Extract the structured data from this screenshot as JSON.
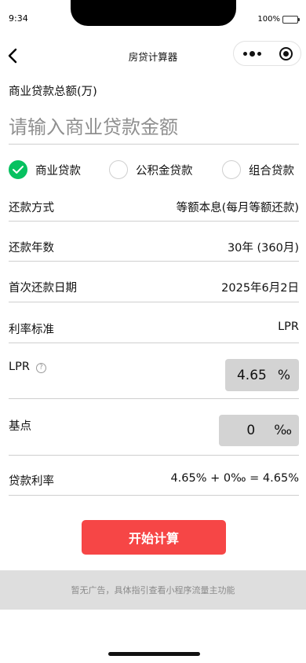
{
  "status_bar": {
    "time": "9:34",
    "battery": "100%"
  },
  "nav": {
    "title": "房贷计算器"
  },
  "loan_amount": {
    "label": "商业贷款总额(万)",
    "placeholder": "请输入商业贷款金额",
    "value": ""
  },
  "loan_types": [
    {
      "label": "商业贷款",
      "checked": true
    },
    {
      "label": "公积金贷款",
      "checked": false
    },
    {
      "label": "组合贷款",
      "checked": false
    }
  ],
  "repayment_method": {
    "label": "还款方式",
    "value": "等额本息(每月等额还款)"
  },
  "loan_years": {
    "label": "还款年数",
    "value": "30年 (360月)"
  },
  "first_payment_date": {
    "label": "首次还款日期",
    "value": "2025年6月2日"
  },
  "rate_standard": {
    "label": "利率标准",
    "value": "LPR"
  },
  "lpr": {
    "label": "LPR",
    "help": "?",
    "value": "4.65",
    "unit": "%"
  },
  "basis_points": {
    "label": "基点",
    "value": "0",
    "unit": "‰"
  },
  "loan_rate": {
    "label": "贷款利率",
    "value": "4.65% + 0‰ = 4.65%"
  },
  "start_button": {
    "label": "开始计算",
    "color": "#f64646"
  },
  "ad": {
    "text": "暂无广告，具体指引查看小程序流量主功能"
  },
  "colors": {
    "accent_green": "#07c160",
    "button_red": "#f64646",
    "input_bg": "#d3d3d3",
    "ad_bg": "#dedede"
  }
}
